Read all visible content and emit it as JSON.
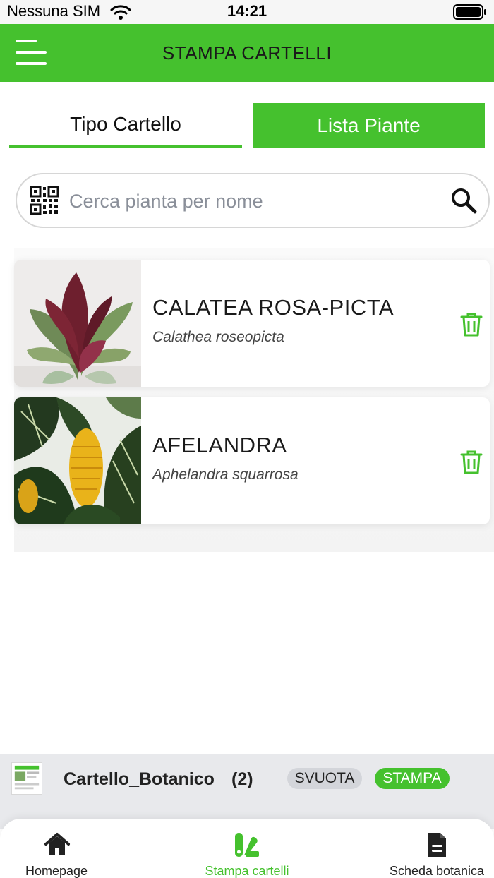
{
  "status_bar": {
    "carrier": "Nessuna SIM",
    "time": "14:21",
    "icons": [
      "wifi-icon",
      "battery-icon"
    ]
  },
  "header": {
    "title": "STAMPA CARTELLI",
    "menu_icon": "hamburger-menu-icon",
    "background_color": "#45c12e"
  },
  "tabs": [
    {
      "label": "Tipo Cartello",
      "active": false
    },
    {
      "label": "Lista Piante",
      "active": true
    }
  ],
  "search": {
    "placeholder": "Cerca pianta per nome",
    "value": "",
    "icons": [
      "qr-code-icon",
      "search-icon"
    ]
  },
  "plants": [
    {
      "name": "CALATEA ROSA-PICTA",
      "scientific_name": "Calathea roseopicta",
      "action_icon": "trash-icon"
    },
    {
      "name": "AFELANDRA",
      "scientific_name": "Aphelandra squarrosa",
      "action_icon": "trash-icon"
    }
  ],
  "summary": {
    "cartello_name": "Cartello_Botanico",
    "count": "(2)",
    "clear_label": "SVUOTA",
    "print_label": "STAMPA"
  },
  "bottom_nav": [
    {
      "label": "Homepage",
      "icon": "home-icon",
      "active": false
    },
    {
      "label": "Stampa cartelli",
      "icon": "print-labels-icon",
      "active": true
    },
    {
      "label": "Scheda botanica",
      "icon": "document-icon",
      "active": false
    }
  ],
  "colors": {
    "accent": "#45c12e",
    "text": "#1c1c1c",
    "muted": "#8a8f99",
    "summary_background": "#e8e9ec"
  }
}
